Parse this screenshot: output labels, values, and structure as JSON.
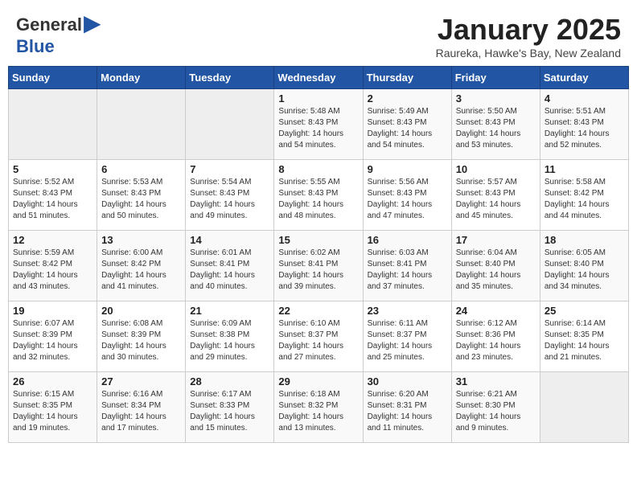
{
  "header": {
    "logo_general": "General",
    "logo_blue": "Blue",
    "month_title": "January 2025",
    "subtitle": "Raureka, Hawke's Bay, New Zealand"
  },
  "weekdays": [
    "Sunday",
    "Monday",
    "Tuesday",
    "Wednesday",
    "Thursday",
    "Friday",
    "Saturday"
  ],
  "weeks": [
    [
      {
        "day": "",
        "empty": true
      },
      {
        "day": "",
        "empty": true
      },
      {
        "day": "",
        "empty": true
      },
      {
        "day": "1",
        "sunrise": "5:48 AM",
        "sunset": "8:43 PM",
        "daylight": "14 hours and 54 minutes."
      },
      {
        "day": "2",
        "sunrise": "5:49 AM",
        "sunset": "8:43 PM",
        "daylight": "14 hours and 54 minutes."
      },
      {
        "day": "3",
        "sunrise": "5:50 AM",
        "sunset": "8:43 PM",
        "daylight": "14 hours and 53 minutes."
      },
      {
        "day": "4",
        "sunrise": "5:51 AM",
        "sunset": "8:43 PM",
        "daylight": "14 hours and 52 minutes."
      }
    ],
    [
      {
        "day": "5",
        "sunrise": "5:52 AM",
        "sunset": "8:43 PM",
        "daylight": "14 hours and 51 minutes."
      },
      {
        "day": "6",
        "sunrise": "5:53 AM",
        "sunset": "8:43 PM",
        "daylight": "14 hours and 50 minutes."
      },
      {
        "day": "7",
        "sunrise": "5:54 AM",
        "sunset": "8:43 PM",
        "daylight": "14 hours and 49 minutes."
      },
      {
        "day": "8",
        "sunrise": "5:55 AM",
        "sunset": "8:43 PM",
        "daylight": "14 hours and 48 minutes."
      },
      {
        "day": "9",
        "sunrise": "5:56 AM",
        "sunset": "8:43 PM",
        "daylight": "14 hours and 47 minutes."
      },
      {
        "day": "10",
        "sunrise": "5:57 AM",
        "sunset": "8:43 PM",
        "daylight": "14 hours and 45 minutes."
      },
      {
        "day": "11",
        "sunrise": "5:58 AM",
        "sunset": "8:42 PM",
        "daylight": "14 hours and 44 minutes."
      }
    ],
    [
      {
        "day": "12",
        "sunrise": "5:59 AM",
        "sunset": "8:42 PM",
        "daylight": "14 hours and 43 minutes."
      },
      {
        "day": "13",
        "sunrise": "6:00 AM",
        "sunset": "8:42 PM",
        "daylight": "14 hours and 41 minutes."
      },
      {
        "day": "14",
        "sunrise": "6:01 AM",
        "sunset": "8:41 PM",
        "daylight": "14 hours and 40 minutes."
      },
      {
        "day": "15",
        "sunrise": "6:02 AM",
        "sunset": "8:41 PM",
        "daylight": "14 hours and 39 minutes."
      },
      {
        "day": "16",
        "sunrise": "6:03 AM",
        "sunset": "8:41 PM",
        "daylight": "14 hours and 37 minutes."
      },
      {
        "day": "17",
        "sunrise": "6:04 AM",
        "sunset": "8:40 PM",
        "daylight": "14 hours and 35 minutes."
      },
      {
        "day": "18",
        "sunrise": "6:05 AM",
        "sunset": "8:40 PM",
        "daylight": "14 hours and 34 minutes."
      }
    ],
    [
      {
        "day": "19",
        "sunrise": "6:07 AM",
        "sunset": "8:39 PM",
        "daylight": "14 hours and 32 minutes."
      },
      {
        "day": "20",
        "sunrise": "6:08 AM",
        "sunset": "8:39 PM",
        "daylight": "14 hours and 30 minutes."
      },
      {
        "day": "21",
        "sunrise": "6:09 AM",
        "sunset": "8:38 PM",
        "daylight": "14 hours and 29 minutes."
      },
      {
        "day": "22",
        "sunrise": "6:10 AM",
        "sunset": "8:37 PM",
        "daylight": "14 hours and 27 minutes."
      },
      {
        "day": "23",
        "sunrise": "6:11 AM",
        "sunset": "8:37 PM",
        "daylight": "14 hours and 25 minutes."
      },
      {
        "day": "24",
        "sunrise": "6:12 AM",
        "sunset": "8:36 PM",
        "daylight": "14 hours and 23 minutes."
      },
      {
        "day": "25",
        "sunrise": "6:14 AM",
        "sunset": "8:35 PM",
        "daylight": "14 hours and 21 minutes."
      }
    ],
    [
      {
        "day": "26",
        "sunrise": "6:15 AM",
        "sunset": "8:35 PM",
        "daylight": "14 hours and 19 minutes."
      },
      {
        "day": "27",
        "sunrise": "6:16 AM",
        "sunset": "8:34 PM",
        "daylight": "14 hours and 17 minutes."
      },
      {
        "day": "28",
        "sunrise": "6:17 AM",
        "sunset": "8:33 PM",
        "daylight": "14 hours and 15 minutes."
      },
      {
        "day": "29",
        "sunrise": "6:18 AM",
        "sunset": "8:32 PM",
        "daylight": "14 hours and 13 minutes."
      },
      {
        "day": "30",
        "sunrise": "6:20 AM",
        "sunset": "8:31 PM",
        "daylight": "14 hours and 11 minutes."
      },
      {
        "day": "31",
        "sunrise": "6:21 AM",
        "sunset": "8:30 PM",
        "daylight": "14 hours and 9 minutes."
      },
      {
        "day": "",
        "empty": true
      }
    ]
  ]
}
